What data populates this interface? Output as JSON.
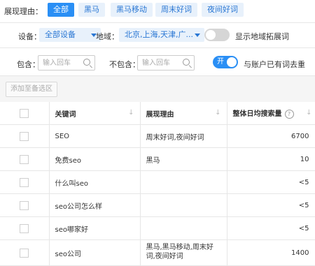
{
  "filters": {
    "reason_label": "展现理由：",
    "chips": [
      "全部",
      "黑马",
      "黑马移动",
      "周末好词",
      "夜间好词"
    ]
  },
  "settings": {
    "device_label": "设备：",
    "device_value": "全部设备",
    "region_label": "地域：",
    "region_value": "北京,上海,天津,广...",
    "region_toggle_label": "显示地域拓展词",
    "region_toggle_on": false
  },
  "include": {
    "include_label": "包含：",
    "include_placeholder": "输入回车",
    "exclude_label": "不包含：",
    "exclude_placeholder": "输入回车",
    "dedupe_toggle_text": "开",
    "dedupe_label": "与账户已有词去重",
    "dedupe_toggle_on": true
  },
  "toolbar": {
    "add_label": "添加至备选区"
  },
  "table": {
    "headers": {
      "keyword": "关键词",
      "reason": "展现理由",
      "avg_search": "整体日均搜索量"
    },
    "rows": [
      {
        "keyword": "SEO",
        "reason": "周末好词,夜间好词",
        "volume": "6700"
      },
      {
        "keyword": "免费seo",
        "reason": "黑马",
        "volume": "10"
      },
      {
        "keyword": "什么叫seo",
        "reason": "",
        "volume": "<5"
      },
      {
        "keyword": "seo公司怎么样",
        "reason": "",
        "volume": "<5"
      },
      {
        "keyword": "seo哪家好",
        "reason": "",
        "volume": "<5"
      },
      {
        "keyword": "seo公司",
        "reason": "黑马,黑马移动,周末好词,夜间好词",
        "volume": "1400"
      }
    ]
  },
  "colors": {
    "accent": "#2a8ff5",
    "chip_bg": "#e8f1fb"
  }
}
